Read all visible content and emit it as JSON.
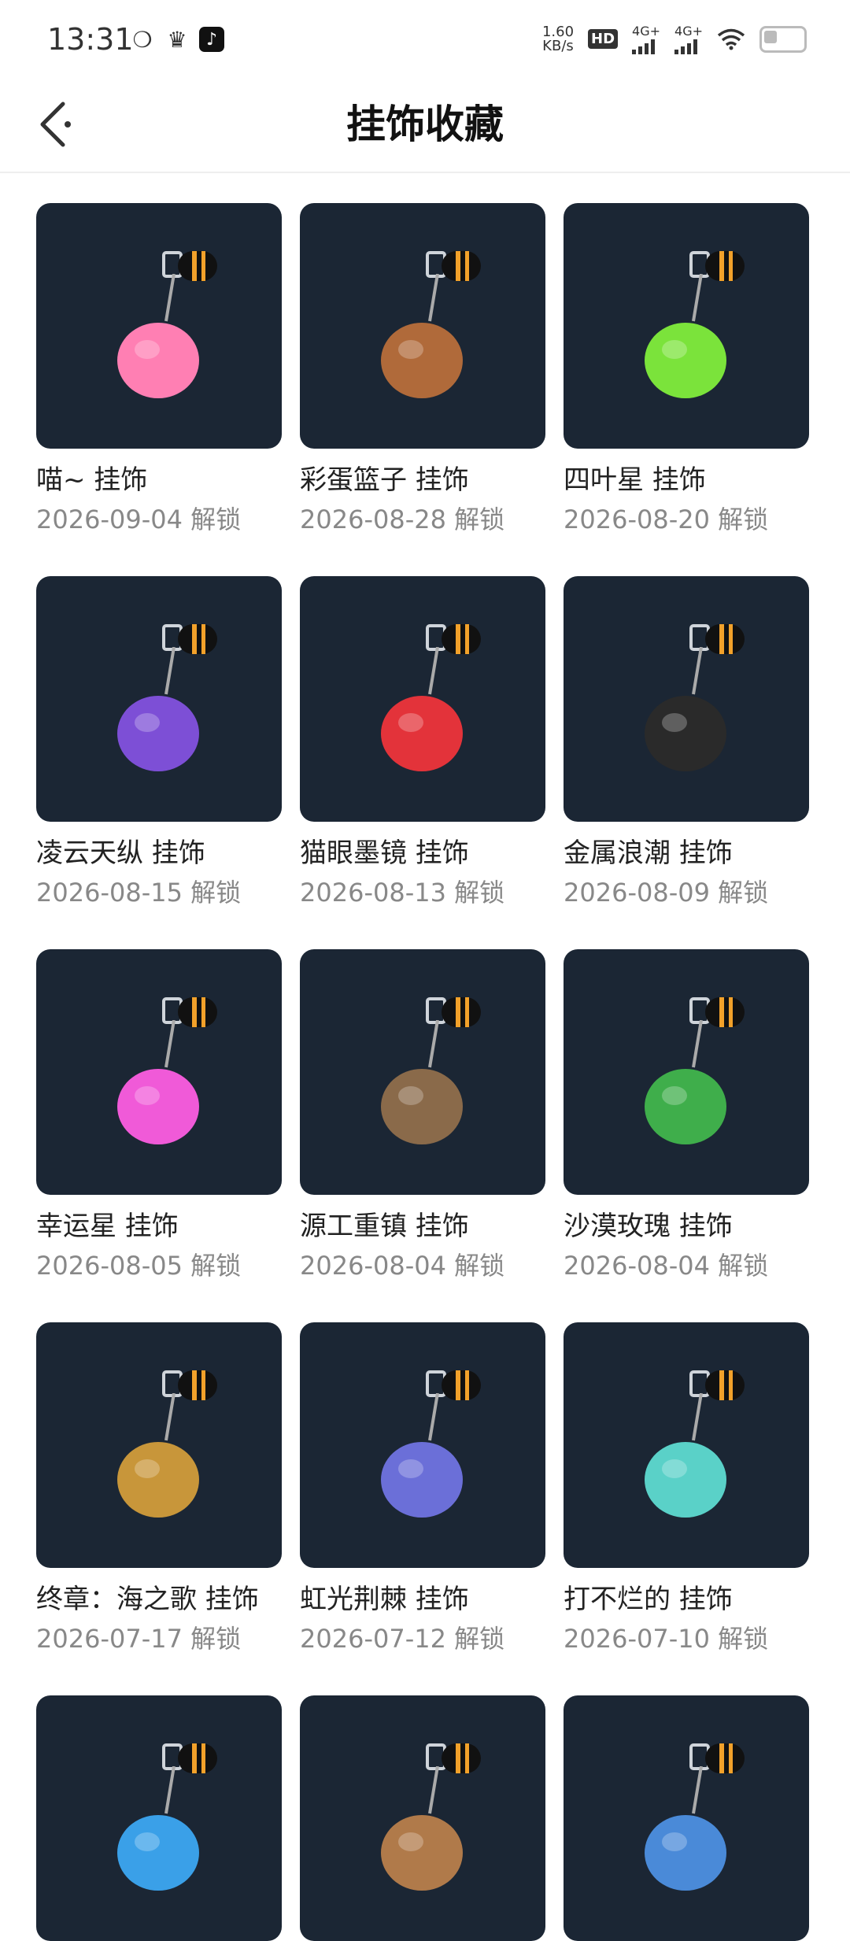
{
  "status_bar": {
    "time": "13:31",
    "speed_top": "1.60",
    "speed_bottom": "KB/s",
    "hd_label": "HD",
    "net1": "4G+",
    "net2": "4G+"
  },
  "header": {
    "title": "挂饰收藏"
  },
  "colors": {
    "card_bg": "#1b2634",
    "accent_orange": "#f2a12a"
  },
  "items": [
    {
      "name": "喵~ 挂饰",
      "date": "2026-09-04 解锁",
      "icon": "yarn-cat-icon",
      "color": "#ff7fb3"
    },
    {
      "name": "彩蛋篮子 挂饰",
      "date": "2026-08-28 解锁",
      "icon": "egg-basket-icon",
      "color": "#b06a3a"
    },
    {
      "name": "四叶星 挂饰",
      "date": "2026-08-20 解锁",
      "icon": "clover-icon",
      "color": "#7be33b"
    },
    {
      "name": "凌云天纵 挂饰",
      "date": "2026-08-15 解锁",
      "icon": "fidget-spinner-icon",
      "color": "#7d4fd6"
    },
    {
      "name": "猫眼墨镜 挂饰",
      "date": "2026-08-13 解锁",
      "icon": "sunglasses-icon",
      "color": "#e3333a"
    },
    {
      "name": "金属浪潮 挂饰",
      "date": "2026-08-09 解锁",
      "icon": "chess-knight-icon",
      "color": "#2a2a2a"
    },
    {
      "name": "幸运星 挂饰",
      "date": "2026-08-05 解锁",
      "icon": "star-icon",
      "color": "#f05ad8"
    },
    {
      "name": "源工重镇 挂饰",
      "date": "2026-08-04 解锁",
      "icon": "floating-island-icon",
      "color": "#8a6a4a"
    },
    {
      "name": "沙漠玫瑰 挂饰",
      "date": "2026-08-04 解锁",
      "icon": "cactus-icon",
      "color": "#3fae4b"
    },
    {
      "name": " 终章：海之歌 挂饰",
      "date": "2026-07-17 解锁",
      "icon": "seashell-icon",
      "color": "#c8963a"
    },
    {
      "name": " 虹光荆棘 挂饰",
      "date": "2026-07-12 解锁",
      "icon": "horn-thorn-icon",
      "color": "#6b6fd8"
    },
    {
      "name": " 打不烂的 挂饰",
      "date": "2026-07-10 解锁",
      "icon": "pinata-icon",
      "color": "#5ad1c8"
    },
    {
      "name": "",
      "date": "",
      "icon": "wave-icon",
      "color": "#3aa0e8"
    },
    {
      "name": "",
      "date": "",
      "icon": "bronze-charm-icon",
      "color": "#b07a4a"
    },
    {
      "name": "",
      "date": "",
      "icon": "fish-icon",
      "color": "#4a8ad8"
    }
  ]
}
